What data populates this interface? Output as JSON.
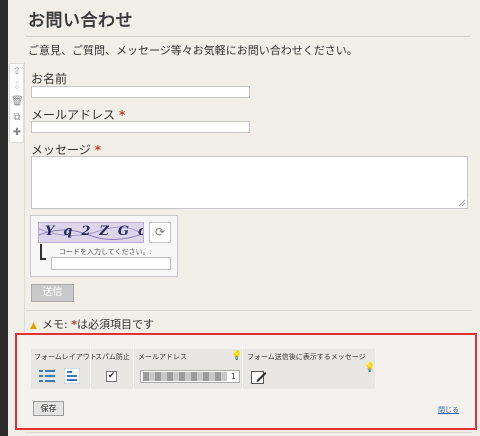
{
  "page": {
    "title": "お問い合わせ",
    "intro": "ご意見、ご質問、メッセージ等々お気軽にお問い合わせください。"
  },
  "toolbar": {
    "icons": [
      "move-up-icon",
      "move-down-icon",
      "delete-icon",
      "copy-icon",
      "add-icon"
    ]
  },
  "form": {
    "name_label": "お名前",
    "email_label": "メールアドレス",
    "email_required": "*",
    "message_label": "メッセージ",
    "message_required": "*",
    "captcha": {
      "image_text": "Yq2ZGc",
      "hint": "コードを入力してください。:"
    },
    "send_label": "送信"
  },
  "memo": {
    "prefix": "メモ:",
    "required_mark": "*",
    "suffix": "は必須項目です"
  },
  "settings": {
    "layout_header": "フォームレイアウト",
    "spam_header": "スパム防止",
    "spam_checked": true,
    "email_header": "メールアドレス",
    "email_value_suffix": "1",
    "message_header": "フォーム送信後に表示するメッセージ",
    "save_label": "保存",
    "close_label": "閉じる"
  },
  "colors": {
    "highlight_border": "#e0303a",
    "link": "#2a5db0",
    "required": "#c0392b"
  }
}
